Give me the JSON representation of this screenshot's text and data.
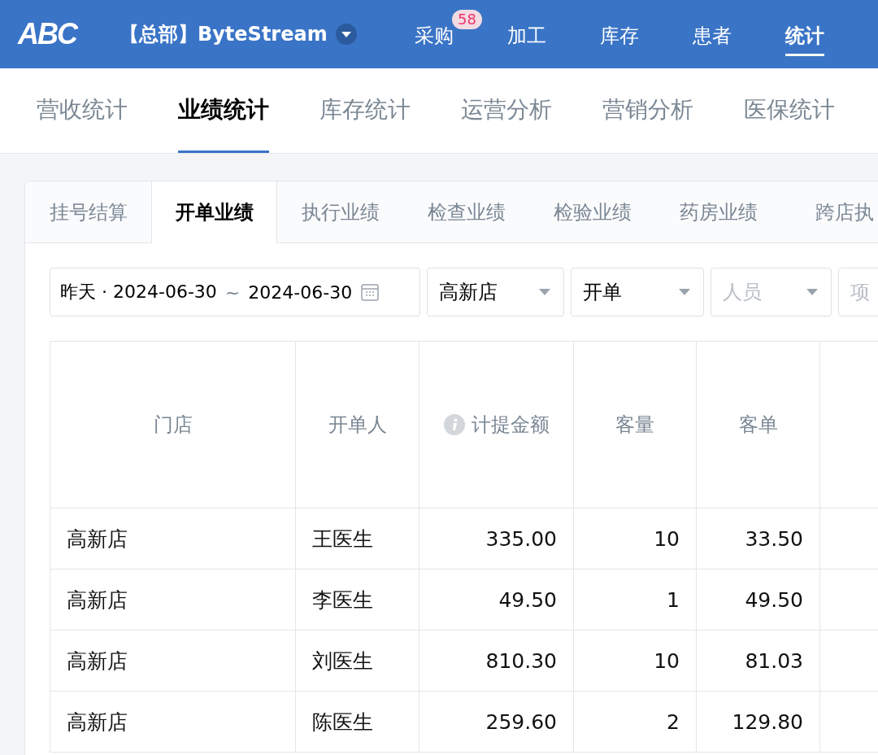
{
  "topbar": {
    "logo": "ABC",
    "org": "【总部】ByteStream",
    "nav": [
      {
        "label": "采购",
        "selected": false,
        "badge": "58"
      },
      {
        "label": "加工",
        "selected": false
      },
      {
        "label": "库存",
        "selected": false
      },
      {
        "label": "患者",
        "selected": false
      },
      {
        "label": "统计",
        "selected": true
      }
    ]
  },
  "section_tabs": [
    {
      "label": "营收统计",
      "selected": false
    },
    {
      "label": "业绩统计",
      "selected": true
    },
    {
      "label": "库存统计",
      "selected": false
    },
    {
      "label": "运营分析",
      "selected": false
    },
    {
      "label": "营销分析",
      "selected": false
    },
    {
      "label": "医保统计",
      "selected": false
    }
  ],
  "sub_tabs": [
    {
      "label": "挂号结算",
      "selected": false
    },
    {
      "label": "开单业绩",
      "selected": true
    },
    {
      "label": "执行业绩",
      "selected": false
    },
    {
      "label": "检查业绩",
      "selected": false
    },
    {
      "label": "检验业绩",
      "selected": false
    },
    {
      "label": "药房业绩",
      "selected": false
    },
    {
      "label": "跨店执",
      "selected": false
    }
  ],
  "filters": {
    "date_prefix": "昨天 · ",
    "date_start": "2024-06-30",
    "date_sep": "~",
    "date_end": "2024-06-30",
    "selects": [
      {
        "value": "高新店"
      },
      {
        "value": "开单"
      },
      {
        "placeholder": "人员"
      },
      {
        "placeholder": "项"
      }
    ]
  },
  "table": {
    "columns": [
      {
        "label": "门店",
        "info": false
      },
      {
        "label": "开单人",
        "info": false
      },
      {
        "label": "计提金额",
        "info": true
      },
      {
        "label": "客量",
        "info": false
      },
      {
        "label": "客单",
        "info": false
      }
    ],
    "rows": [
      [
        "高新店",
        "王医生",
        "335.00",
        "10",
        "33.50"
      ],
      [
        "高新店",
        "李医生",
        "49.50",
        "1",
        "49.50"
      ],
      [
        "高新店",
        "刘医生",
        "810.30",
        "10",
        "81.03"
      ],
      [
        "高新店",
        "陈医生",
        "259.60",
        "2",
        "129.80"
      ]
    ]
  }
}
